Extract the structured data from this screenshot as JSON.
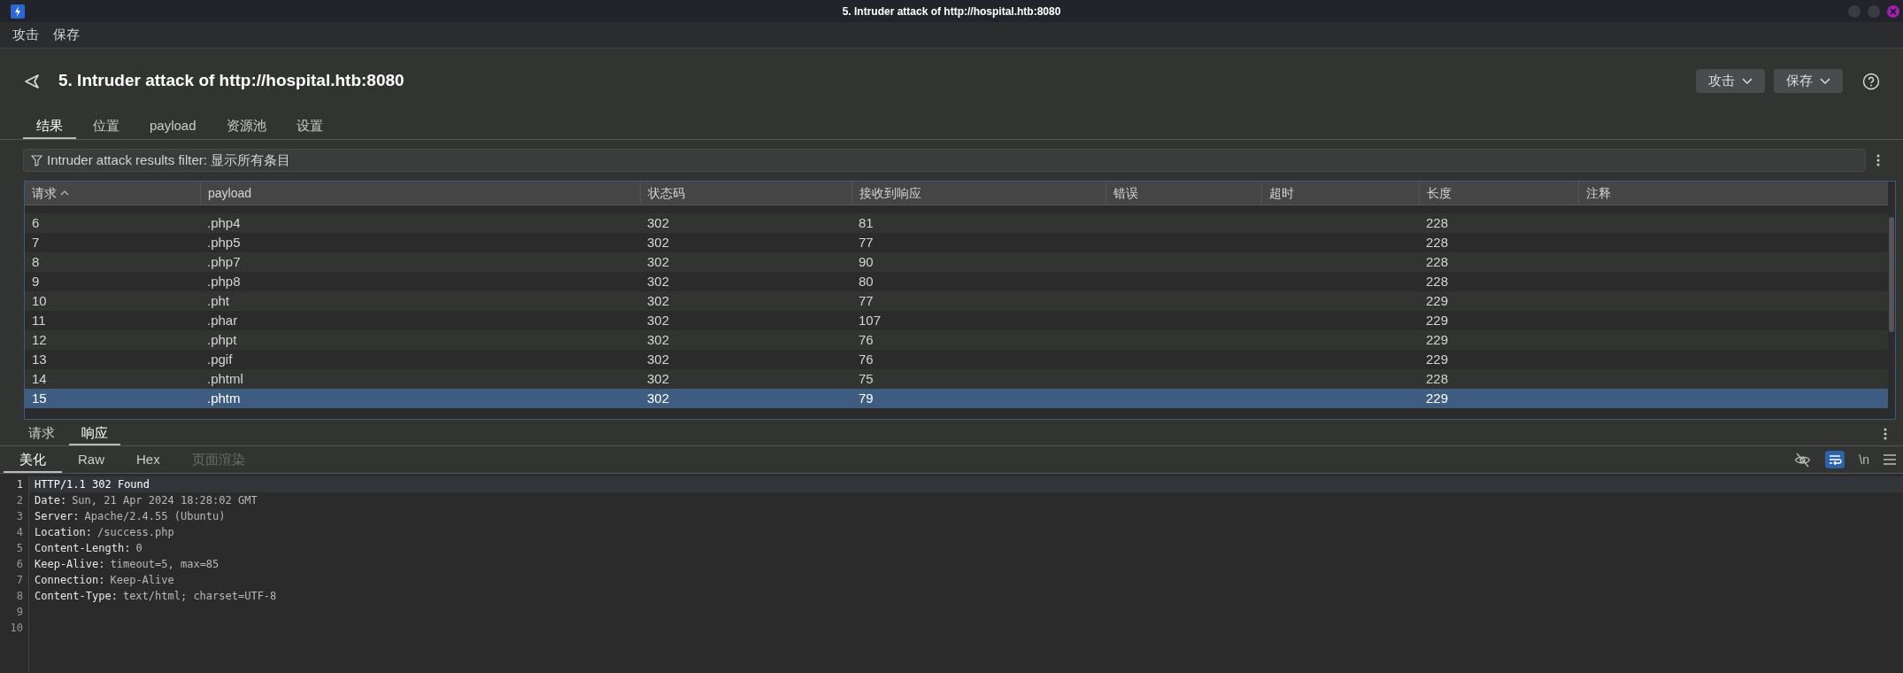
{
  "window": {
    "title": "5. Intruder attack of http://hospital.htb:8080"
  },
  "menu": [
    "攻击",
    "保存"
  ],
  "header": {
    "title": "5. Intruder attack of http://hospital.htb:8080",
    "buttons": [
      "攻击",
      "保存"
    ]
  },
  "tabs": [
    {
      "label": "结果",
      "selected": true
    },
    {
      "label": "位置",
      "selected": false
    },
    {
      "label": "payload",
      "selected": false
    },
    {
      "label": "资源池",
      "selected": false
    },
    {
      "label": "设置",
      "selected": false
    }
  ],
  "filter": {
    "text": "Intruder attack results filter: 显示所有条目"
  },
  "table": {
    "columns": [
      {
        "label": "请求",
        "sorted": true
      },
      {
        "label": "payload",
        "sorted": false
      },
      {
        "label": "状态码",
        "sorted": false
      },
      {
        "label": "接收到响应",
        "sorted": false
      },
      {
        "label": "错误",
        "sorted": false
      },
      {
        "label": "超时",
        "sorted": false
      },
      {
        "label": "长度",
        "sorted": false
      },
      {
        "label": "注释",
        "sorted": false
      }
    ],
    "rows": [
      {
        "cells": [
          "6",
          ".php4",
          "302",
          "81",
          "",
          "",
          "228",
          ""
        ],
        "selected": false
      },
      {
        "cells": [
          "7",
          ".php5",
          "302",
          "77",
          "",
          "",
          "228",
          ""
        ],
        "selected": false
      },
      {
        "cells": [
          "8",
          ".php7",
          "302",
          "90",
          "",
          "",
          "228",
          ""
        ],
        "selected": false
      },
      {
        "cells": [
          "9",
          ".php8",
          "302",
          "80",
          "",
          "",
          "228",
          ""
        ],
        "selected": false
      },
      {
        "cells": [
          "10",
          ".pht",
          "302",
          "77",
          "",
          "",
          "229",
          ""
        ],
        "selected": false
      },
      {
        "cells": [
          "11",
          ".phar",
          "302",
          "107",
          "",
          "",
          "229",
          ""
        ],
        "selected": false
      },
      {
        "cells": [
          "12",
          ".phpt",
          "302",
          "76",
          "",
          "",
          "229",
          ""
        ],
        "selected": false
      },
      {
        "cells": [
          "13",
          ".pgif",
          "302",
          "76",
          "",
          "",
          "229",
          ""
        ],
        "selected": false
      },
      {
        "cells": [
          "14",
          ".phtml",
          "302",
          "75",
          "",
          "",
          "228",
          ""
        ],
        "selected": false
      },
      {
        "cells": [
          "15",
          ".phtm",
          "302",
          "79",
          "",
          "",
          "229",
          ""
        ],
        "selected": true
      }
    ]
  },
  "message_tabs": [
    {
      "label": "请求",
      "selected": false
    },
    {
      "label": "响应",
      "selected": true
    }
  ],
  "view_tabs": [
    {
      "label": "美化",
      "selected": true,
      "disabled": false
    },
    {
      "label": "Raw",
      "selected": false,
      "disabled": false
    },
    {
      "label": "Hex",
      "selected": false,
      "disabled": false
    },
    {
      "label": "页面渲染",
      "selected": false,
      "disabled": true
    }
  ],
  "view_toolbar": {
    "wrap_on": true,
    "newline_label": "\\n"
  },
  "response_lines": [
    {
      "number": "1",
      "text": "HTTP/1.1 302 Found",
      "selected": true
    },
    {
      "number": "2",
      "name": "Date:",
      "value": "Sun, 21 Apr 2024 18:28:02 GMT",
      "selected": false
    },
    {
      "number": "3",
      "name": "Server:",
      "value": "Apache/2.4.55 (Ubuntu)",
      "selected": false
    },
    {
      "number": "4",
      "name": "Location:",
      "value": "/success.php",
      "selected": false
    },
    {
      "number": "5",
      "name": "Content-Length:",
      "value": "0",
      "selected": false
    },
    {
      "number": "6",
      "name": "Keep-Alive:",
      "value": "timeout=5, max=85",
      "selected": false
    },
    {
      "number": "7",
      "name": "Connection:",
      "value": "Keep-Alive",
      "selected": false
    },
    {
      "number": "8",
      "name": "Content-Type:",
      "value": "text/html; charset=UTF-8",
      "selected": false
    },
    {
      "number": "9",
      "selected": false
    },
    {
      "number": "10",
      "selected": false
    }
  ]
}
